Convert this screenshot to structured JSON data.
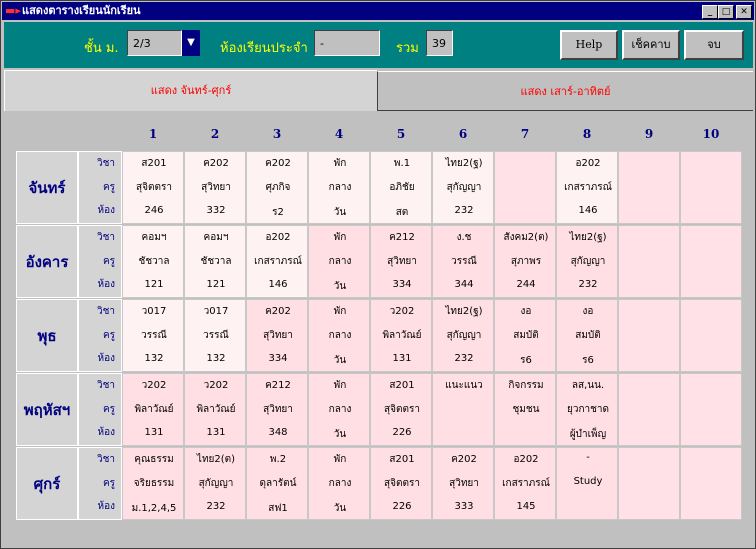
{
  "window": {
    "title": "แสดงตารางเรียนนักเรียน",
    "controls": [
      "_",
      "□",
      "✕"
    ]
  },
  "toolbar": {
    "grade_label": "ชั้น ม.",
    "grade_value": "2/3",
    "homeroom_label": "ห้องเรียนประจำ",
    "homeroom_value": "-",
    "total_label": "รวม",
    "total_value": "39",
    "help_label": "Help",
    "check_label": "เช็คคาบ",
    "end_label": "จบ"
  },
  "tabs": [
    {
      "label": "แสดง จันทร์-ศุกร์",
      "active": true
    },
    {
      "label": "แสดง เสาร์-อาทิตย์",
      "active": false
    }
  ],
  "periods": [
    "1",
    "2",
    "3",
    "4",
    "5",
    "6",
    "7",
    "8",
    "9",
    "10"
  ],
  "row_keys": [
    "วิชา",
    "ครู",
    "ห้อง"
  ],
  "colors": {
    "cell_light": "#fff2f2",
    "cell_pink": "#ffdfe4",
    "cell_empty": "#ffe1e7",
    "accent": "#008080",
    "title_bar": "#000080"
  },
  "days": [
    {
      "name": "จันทร์",
      "cells": [
        [
          "ส201",
          "สุจิตตรา",
          "246"
        ],
        [
          "ค202",
          "สุวิทยา",
          "332"
        ],
        [
          "ค202",
          "ศุภกิจ",
          "ร2"
        ],
        [
          "พัก",
          "กลาง",
          "วัน"
        ],
        [
          "พ.1",
          "อภิชัย",
          "สต"
        ],
        [
          "ไทย2(ฐ)",
          "สุกัญญา",
          "232"
        ],
        [
          "",
          "",
          ""
        ],
        [
          "อ202",
          "เกสราภรณ์",
          "146"
        ],
        [
          "",
          "",
          ""
        ],
        [
          "",
          "",
          ""
        ]
      ]
    },
    {
      "name": "อังคาร",
      "cells": [
        [
          "คอมฯ",
          "ชัชวาล",
          "121"
        ],
        [
          "คอมฯ",
          "ชัชวาล",
          "121"
        ],
        [
          "อ202",
          "เกสราภรณ์",
          "146"
        ],
        [
          "พัก",
          "กลาง",
          "วัน"
        ],
        [
          "ค212",
          "สุวิทยา",
          "334"
        ],
        [
          "ง.ช",
          "วรรณี",
          "344"
        ],
        [
          "สังคม2(ต)",
          "สุภาพร",
          "244"
        ],
        [
          "ไทย2(ฐ)",
          "สุกัญญา",
          "232"
        ],
        [
          "",
          "",
          ""
        ],
        [
          "",
          "",
          ""
        ]
      ]
    },
    {
      "name": "พุธ",
      "cells": [
        [
          "ว017",
          "วรรณี",
          "132"
        ],
        [
          "ว017",
          "วรรณี",
          "132"
        ],
        [
          "ค202",
          "สุวิทยา",
          "334"
        ],
        [
          "พัก",
          "กลาง",
          "วัน"
        ],
        [
          "ว202",
          "พิลาวัณย์",
          "131"
        ],
        [
          "ไทย2(ฐ)",
          "สุกัญญา",
          "232"
        ],
        [
          "งอ",
          "สมบัติ",
          "ร6"
        ],
        [
          "งอ",
          "สมบัติ",
          "ร6"
        ],
        [
          "",
          "",
          ""
        ],
        [
          "",
          "",
          ""
        ]
      ]
    },
    {
      "name": "พฤหัสฯ",
      "cells": [
        [
          "ว202",
          "พิลาวัณย์",
          "131"
        ],
        [
          "ว202",
          "พิลาวัณย์",
          "131"
        ],
        [
          "ค212",
          "สุวิทยา",
          "348"
        ],
        [
          "พัก",
          "กลาง",
          "วัน"
        ],
        [
          "ส201",
          "สุจิตตรา",
          "226"
        ],
        [
          "แนะแนว",
          "",
          ""
        ],
        [
          "กิจกรรม",
          "ชุมชน",
          ""
        ],
        [
          "ลส,นน.",
          "ยุวกาชาด",
          "ผู้บำเพ็ญ"
        ],
        [
          "",
          "",
          ""
        ],
        [
          "",
          "",
          ""
        ]
      ]
    },
    {
      "name": "ศุกร์",
      "cells": [
        [
          "คุณธรรม",
          "จริยธรรม",
          "ม.1,2,4,5"
        ],
        [
          "ไทย2(ต)",
          "สุกัญญา",
          "232"
        ],
        [
          "พ.2",
          "ดุลารัตน์",
          "สฟ1"
        ],
        [
          "พัก",
          "กลาง",
          "วัน"
        ],
        [
          "ส201",
          "สุจิตตรา",
          "226"
        ],
        [
          "ค202",
          "สุวิทยา",
          "333"
        ],
        [
          "อ202",
          "เกสราภรณ์",
          "145"
        ],
        [
          "-",
          "Study",
          ""
        ],
        [
          "",
          "",
          ""
        ],
        [
          "",
          "",
          ""
        ]
      ]
    }
  ]
}
